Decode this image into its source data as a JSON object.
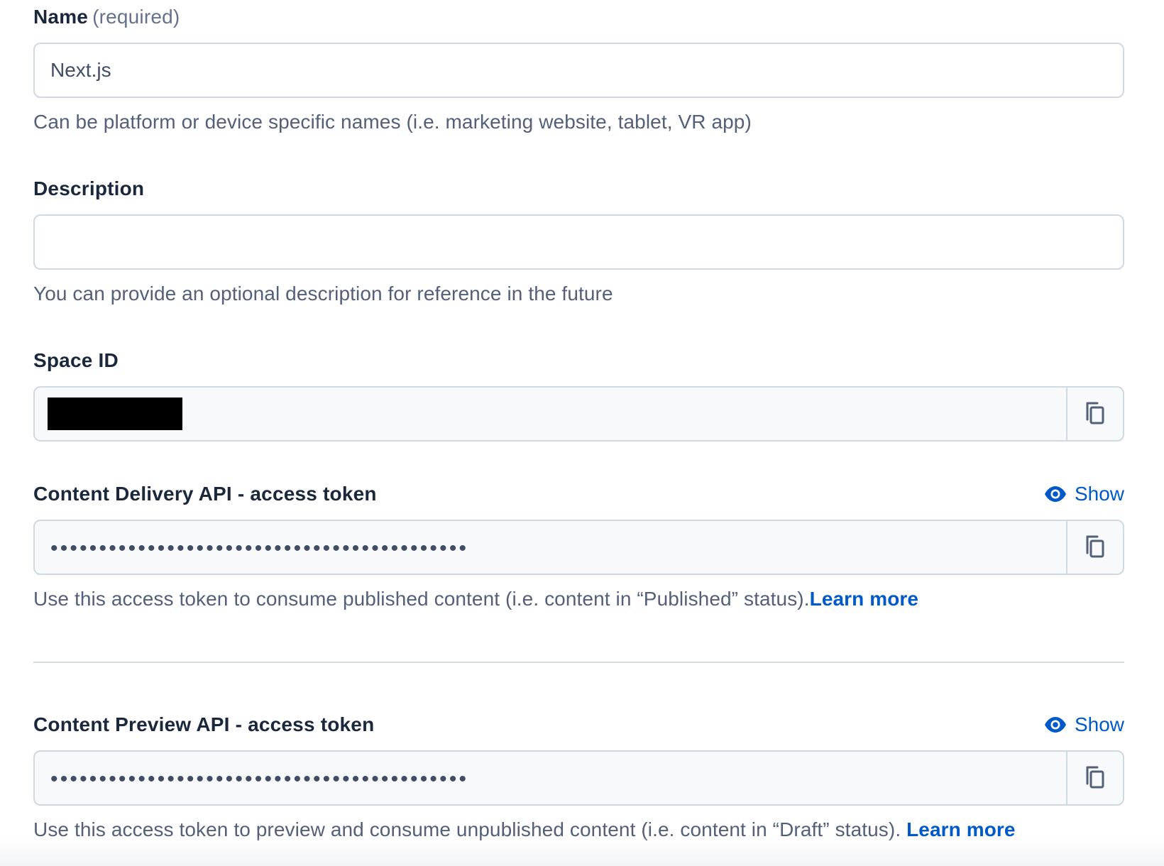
{
  "name_field": {
    "label": "Name",
    "required_hint": "(required)",
    "value": "Next.js",
    "help": "Can be platform or device specific names (i.e. marketing website, tablet, VR app)"
  },
  "description_field": {
    "label": "Description",
    "value": "",
    "help": "You can provide an optional description for reference in the future"
  },
  "space_id_field": {
    "label": "Space ID"
  },
  "delivery_token": {
    "label": "Content Delivery API - access token",
    "show_label": "Show",
    "masked_value": "•••••••••••••••••••••••••••••••••••••••••••",
    "help": "Use this access token to consume published content (i.e. content in “Published” status).",
    "learn_more": "Learn more"
  },
  "preview_token": {
    "label": "Content Preview API - access token",
    "show_label": "Show",
    "masked_value": "•••••••••••••••••••••••••••••••••••••••••••",
    "help": "Use this access token to preview and consume unpublished content (i.e. content in “Draft” status). ",
    "learn_more": "Learn more"
  },
  "icons": {
    "copy": "copy-icon",
    "eye": "eye-icon"
  },
  "colors": {
    "link": "#0059c8",
    "border": "#cfd9e0",
    "readonly_bg": "#f7f9fa",
    "text": "#1b273a",
    "help_text": "#536078"
  }
}
